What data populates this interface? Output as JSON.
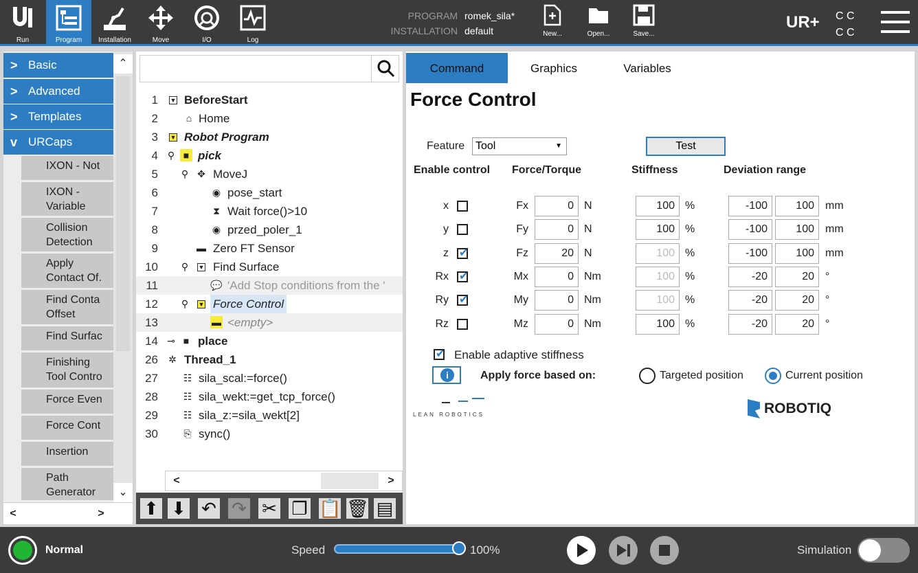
{
  "topbar": {
    "nav": [
      {
        "label": "Run",
        "icon": "ur-run-icon"
      },
      {
        "label": "Program",
        "icon": "program-icon"
      },
      {
        "label": "Installation",
        "icon": "installation-icon"
      },
      {
        "label": "Move",
        "icon": "move-icon"
      },
      {
        "label": "I/O",
        "icon": "io-icon"
      },
      {
        "label": "Log",
        "icon": "log-icon"
      }
    ],
    "program_label": "PROGRAM",
    "program_value": "romek_sila*",
    "installation_label": "INSTALLATION",
    "installation_value": "default",
    "file": [
      {
        "label": "New..."
      },
      {
        "label": "Open..."
      },
      {
        "label": "Save..."
      }
    ],
    "cc": "C C\nC C"
  },
  "palette": {
    "categories": [
      "Basic",
      "Advanced",
      "Templates",
      "URCaps"
    ],
    "urcaps": [
      "IXON - Notification",
      "IXON - Variable",
      "Collision Detection",
      "Apply Contact Offset",
      "Find Contact Offset",
      "Find Surface",
      "Finishing Tool Control",
      "Force Event",
      "Force Control",
      "Insertion",
      "Path Generator"
    ],
    "urcaps_display": [
      "IXON - Not",
      "IXON -\nVariable",
      "Collision\nDetection",
      "Apply\nContact Of.",
      "Find Conta\nOffset",
      "Find Surfac",
      "Finishing\nTool Contro",
      "Force Even",
      "Force Cont",
      "Insertion",
      "Path\nGenerator"
    ]
  },
  "tree": {
    "search_placeholder": "",
    "rows": [
      {
        "n": "1",
        "text": "BeforeStart"
      },
      {
        "n": "2",
        "text": "Home"
      },
      {
        "n": "3",
        "text": "Robot Program"
      },
      {
        "n": "4",
        "text": "pick"
      },
      {
        "n": "5",
        "text": "MoveJ"
      },
      {
        "n": "6",
        "text": "pose_start"
      },
      {
        "n": "7",
        "text": "Wait force()>10"
      },
      {
        "n": "8",
        "text": "przed_poler_1"
      },
      {
        "n": "9",
        "text": "Zero FT Sensor"
      },
      {
        "n": "10",
        "text": "Find Surface"
      },
      {
        "n": "11",
        "text": "'Add Stop conditions from the '"
      },
      {
        "n": "12",
        "text": "Force Control"
      },
      {
        "n": "13",
        "text": "<empty>"
      },
      {
        "n": "14",
        "text": "place"
      },
      {
        "n": "26",
        "text": "Thread_1"
      },
      {
        "n": "27",
        "text": "sila_scal:=force()"
      },
      {
        "n": "28",
        "text": "sila_wekt:=get_tcp_force()"
      },
      {
        "n": "29",
        "text": "sila_z:=sila_wekt[2]"
      },
      {
        "n": "30",
        "text": "sync()"
      }
    ]
  },
  "panel": {
    "tabs": [
      "Command",
      "Graphics",
      "Variables"
    ],
    "title": "Force Control",
    "feature_label": "Feature",
    "feature_value": "Tool",
    "test_label": "Test",
    "headers": {
      "enable": "Enable control",
      "force": "Force/Torque",
      "stiffness": "Stiffness",
      "deviation": "Deviation range"
    },
    "axes": [
      {
        "axis": "x",
        "on": false,
        "f": "Fx",
        "val": "0",
        "unit": "N",
        "stiff": "100",
        "stiff_enabled": true,
        "min": "-100",
        "max": "100",
        "dunit": "mm"
      },
      {
        "axis": "y",
        "on": false,
        "f": "Fy",
        "val": "0",
        "unit": "N",
        "stiff": "100",
        "stiff_enabled": true,
        "min": "-100",
        "max": "100",
        "dunit": "mm"
      },
      {
        "axis": "z",
        "on": true,
        "f": "Fz",
        "val": "20",
        "unit": "N",
        "stiff": "100",
        "stiff_enabled": false,
        "min": "-100",
        "max": "100",
        "dunit": "mm"
      },
      {
        "axis": "Rx",
        "on": true,
        "f": "Mx",
        "val": "0",
        "unit": "Nm",
        "stiff": "100",
        "stiff_enabled": false,
        "min": "-20",
        "max": "20",
        "dunit": "°"
      },
      {
        "axis": "Ry",
        "on": true,
        "f": "My",
        "val": "0",
        "unit": "Nm",
        "stiff": "100",
        "stiff_enabled": false,
        "min": "-20",
        "max": "20",
        "dunit": "°"
      },
      {
        "axis": "Rz",
        "on": false,
        "f": "Mz",
        "val": "0",
        "unit": "Nm",
        "stiff": "100",
        "stiff_enabled": true,
        "min": "-20",
        "max": "20",
        "dunit": "°"
      }
    ],
    "percent": "%",
    "adaptive_label": "Enable adaptive stiffness",
    "apply_label": "Apply force based on:",
    "targeted": "Targeted position",
    "current": "Current position",
    "lean": "LEAN ROBOTICS",
    "robotiq": "ROBOTIQ"
  },
  "bottombar": {
    "status": "Normal",
    "speed_label": "Speed",
    "speed_value": "100%",
    "speed_fraction": 1.0,
    "simulation_label": "Simulation"
  },
  "colors": {
    "accent": "#2d7dc3",
    "topbar": "#3b3b3b",
    "status_ok": "#21b534"
  }
}
